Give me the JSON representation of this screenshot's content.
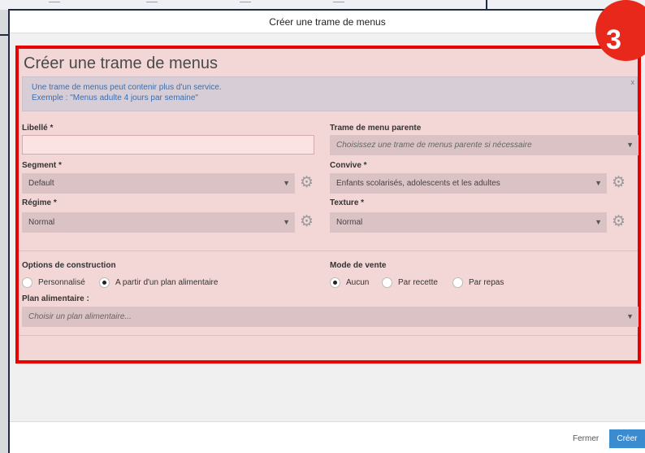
{
  "modal": {
    "header_title": "Créer une trame de menus",
    "panel_title": "Créer une trame de menus",
    "step_badge": "3",
    "alert": {
      "line1": "Une trame de menus peut contenir plus d'un service.",
      "line2": "Exemple : \"Menus adulte 4 jours par semaine\"",
      "close": "x"
    }
  },
  "form": {
    "libelle_label": "Libellé *",
    "libelle_value": "",
    "parent_label": "Trame de menu parente",
    "parent_placeholder": "Choisissez une trame de menus parente si nécessaire",
    "segment_label": "Segment *",
    "segment_value": "Default",
    "convive_label": "Convive *",
    "convive_value": "Enfants scolarisés, adolescents et les adultes",
    "regime_label": "Régime *",
    "regime_value": "Normal",
    "texture_label": "Texture *",
    "texture_value": "Normal",
    "options_label": "Options de construction",
    "options": [
      {
        "label": "Personnalisé",
        "selected": false
      },
      {
        "label": "A partir d'un plan alimentaire",
        "selected": true
      }
    ],
    "mode_label": "Mode de vente",
    "modes": [
      {
        "label": "Aucun",
        "selected": true
      },
      {
        "label": "Par recette",
        "selected": false
      },
      {
        "label": "Par repas",
        "selected": false
      }
    ],
    "plan_label": "Plan alimentaire :",
    "plan_placeholder": "Choisir un plan alimentaire..."
  },
  "footer": {
    "close_label": "Fermer",
    "create_label": "Créer"
  },
  "colors": {
    "highlight_border": "#e60000",
    "badge": "#e8281b",
    "primary_button": "#3a8bd0"
  }
}
